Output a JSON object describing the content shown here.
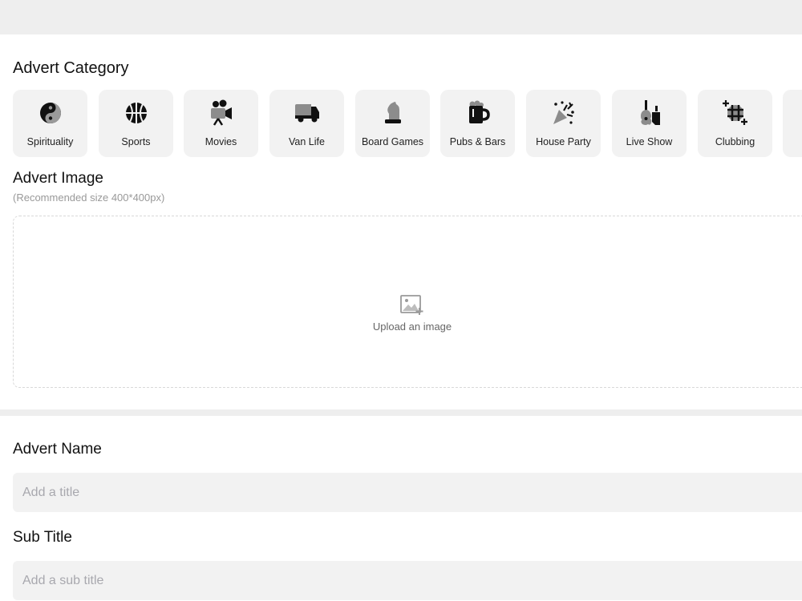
{
  "category_section": {
    "heading": "Advert Category",
    "items": [
      {
        "label": "Spirituality",
        "icon": "yin-yang-icon"
      },
      {
        "label": "Sports",
        "icon": "basketball-icon"
      },
      {
        "label": "Movies",
        "icon": "video-camera-icon"
      },
      {
        "label": "Van Life",
        "icon": "van-icon"
      },
      {
        "label": "Board Games",
        "icon": "chess-knight-icon"
      },
      {
        "label": "Pubs & Bars",
        "icon": "beer-mug-icon"
      },
      {
        "label": "House Party",
        "icon": "party-popper-icon"
      },
      {
        "label": "Live Show",
        "icon": "guitar-icon"
      },
      {
        "label": "Clubbing",
        "icon": "disco-ball-icon"
      }
    ]
  },
  "image_section": {
    "heading": "Advert Image",
    "note": "(Recommended size 400*400px)",
    "upload_label": "Upload an image",
    "upload_icon": "image-add-icon"
  },
  "name_section": {
    "heading": "Advert Name",
    "placeholder": "Add a title"
  },
  "subtitle_section": {
    "heading": "Sub Title",
    "placeholder": "Add a sub title"
  },
  "colors": {
    "background": "#ffffff",
    "panel": "#eeeeee",
    "tile": "#f2f2f2",
    "placeholder": "#a8a8ae"
  }
}
